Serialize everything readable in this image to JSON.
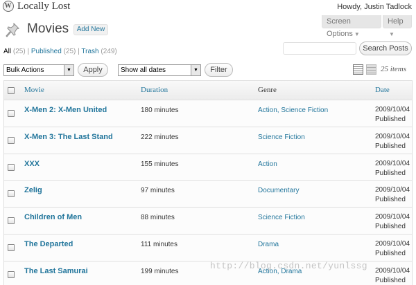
{
  "topbar": {
    "site_name": "Locally Lost",
    "howdy": "Howdy, Justin Tadlock"
  },
  "screen_meta": {
    "screen_options": "Screen Options",
    "help": "Help"
  },
  "header": {
    "title": "Movies",
    "add_new": "Add New"
  },
  "views": {
    "all_label": "All",
    "all_count": "(25)",
    "published_label": "Published",
    "published_count": "(25)",
    "trash_label": "Trash",
    "trash_count": "(249)",
    "separator": "|"
  },
  "search": {
    "placeholder": "",
    "button": "Search Posts"
  },
  "tablenav": {
    "bulk_actions": "Bulk Actions",
    "apply": "Apply",
    "dates": "Show all dates",
    "filter": "Filter",
    "items_count": "25 items"
  },
  "table": {
    "columns": [
      "Movie",
      "Duration",
      "Genre",
      "Date"
    ],
    "rows": [
      {
        "title": "X-Men 2: X-Men United",
        "duration": "180 minutes",
        "genre": "Action, Science Fiction",
        "date": "2009/10/04",
        "status": "Published"
      },
      {
        "title": "X-Men 3: The Last Stand",
        "duration": "222 minutes",
        "genre": "Science Fiction",
        "date": "2009/10/04",
        "status": "Published"
      },
      {
        "title": "XXX",
        "duration": "155 minutes",
        "genre": "Action",
        "date": "2009/10/04",
        "status": "Published"
      },
      {
        "title": "Zelig",
        "duration": "97 minutes",
        "genre": "Documentary",
        "date": "2009/10/04",
        "status": "Published"
      },
      {
        "title": "Children of Men",
        "duration": "88 minutes",
        "genre": "Science Fiction",
        "date": "2009/10/04",
        "status": "Published"
      },
      {
        "title": "The Departed",
        "duration": "111 minutes",
        "genre": "Drama",
        "date": "2009/10/04",
        "status": "Published"
      },
      {
        "title": "The Last Samurai",
        "duration": "199 minutes",
        "genre": "Action, Drama",
        "date": "2009/10/04",
        "status": "Published"
      }
    ]
  },
  "watermark": "http://blog.csdn.net/yunlssg",
  "colors": {
    "link": "#21759b",
    "header_bg": "#ececec",
    "border": "#dfdfdf"
  },
  "icons": [
    "wordpress-logo-icon",
    "pushpin-icon",
    "dropdown-arrow-icon",
    "list-view-icon",
    "excerpt-view-icon"
  ]
}
